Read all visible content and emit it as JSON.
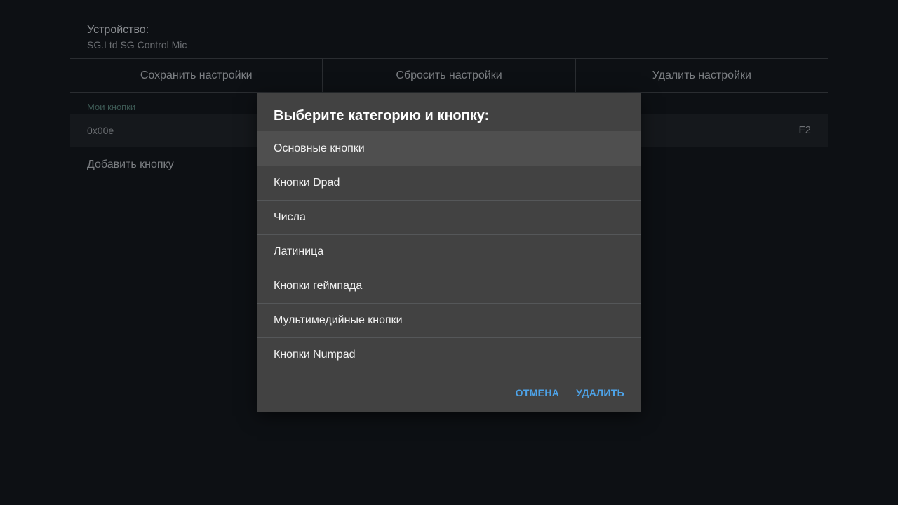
{
  "device": {
    "label": "Устройство:",
    "name": "SG.Ltd SG Control Mic"
  },
  "actions": {
    "save_label": "Сохранить настройки",
    "reset_label": "Сбросить настройки",
    "delete_label": "Удалить настройки"
  },
  "bindings": {
    "section_label": "Мои кнопки",
    "rows": [
      {
        "code": "0x00e",
        "key": "F2"
      }
    ],
    "add_label": "Добавить кнопку"
  },
  "dialog": {
    "title": "Выберите категорию и кнопку:",
    "categories": [
      {
        "label": "Основные кнопки",
        "selected": true
      },
      {
        "label": "Кнопки Dpad",
        "selected": false
      },
      {
        "label": "Числа",
        "selected": false
      },
      {
        "label": "Латиница",
        "selected": false
      },
      {
        "label": "Кнопки геймпада",
        "selected": false
      },
      {
        "label": "Мультимедийные кнопки",
        "selected": false
      },
      {
        "label": "Кнопки Numpad",
        "selected": false
      }
    ],
    "cancel_label": "ОТМЕНА",
    "delete_label": "УДАЛИТЬ"
  },
  "colors": {
    "background": "#0d1014",
    "dialog_bg": "#424242",
    "accent": "#4da3e8",
    "section_label": "#3d5a55"
  }
}
